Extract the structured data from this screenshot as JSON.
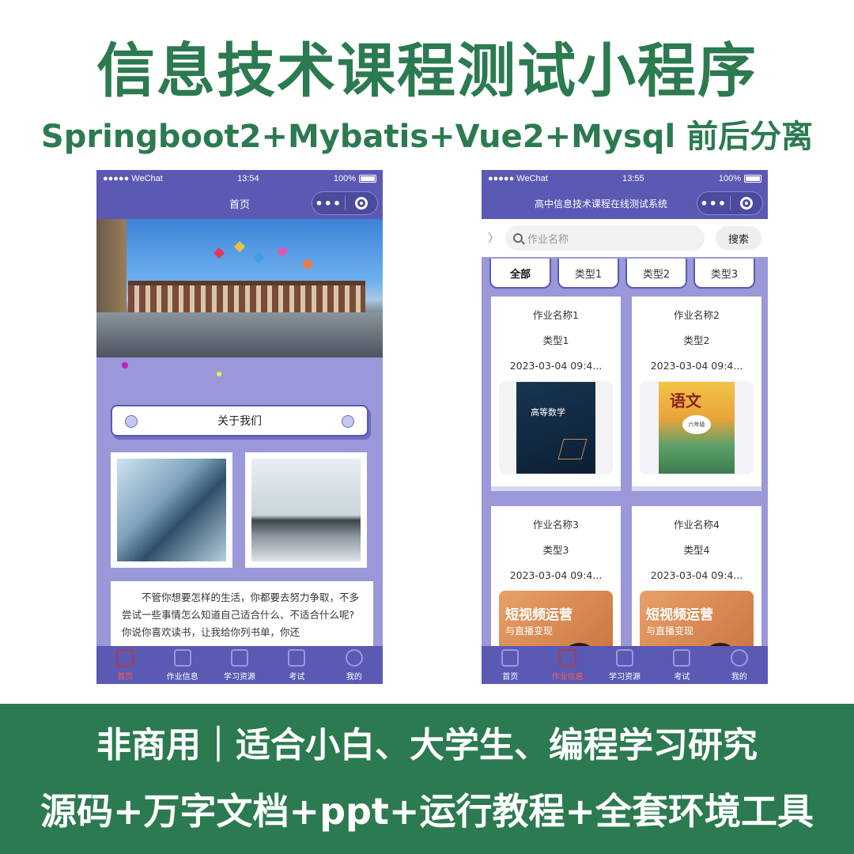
{
  "headline": "信息技术课程测试小程序",
  "subline": "Springboot2+Mybatis+Vue2+Mysql 前后分离",
  "left_phone": {
    "status": {
      "carrier": "●●●●● WeChat",
      "time": "13:54",
      "battery": "100%"
    },
    "nav_title": "首页",
    "about_button": "关于我们",
    "intro_text": "不管你想要怎样的生活，你都要去努力争取，不多尝试一些事情怎么知道自己适合什么、不适合什么呢? 你说你喜欢读书，让我给你列书单，你还",
    "tabs": [
      {
        "label": "首页",
        "active": true
      },
      {
        "label": "作业信息",
        "active": false
      },
      {
        "label": "学习资源",
        "active": false
      },
      {
        "label": "考试",
        "active": false
      },
      {
        "label": "我的",
        "active": false
      }
    ]
  },
  "right_phone": {
    "status": {
      "carrier": "●●●●● WeChat",
      "time": "13:55",
      "battery": "100%"
    },
    "nav_title": "高中信息技术课程在线测试系统",
    "search": {
      "placeholder": "作业名称",
      "button": "搜索"
    },
    "categories": [
      {
        "label": "全部",
        "active": true
      },
      {
        "label": "类型1",
        "active": false
      },
      {
        "label": "类型2",
        "active": false
      },
      {
        "label": "类型3",
        "active": false
      }
    ],
    "works": [
      {
        "name": "作业名称1",
        "type": "类型1",
        "date": "2023-03-04 09:4...",
        "cover": "高等数学"
      },
      {
        "name": "作业名称2",
        "type": "类型2",
        "date": "2023-03-04 09:4...",
        "cover": "语文",
        "cover_sub": "六年级"
      },
      {
        "name": "作业名称3",
        "type": "类型3",
        "date": "2023-03-04 09:4...",
        "cover": "短视频运营",
        "cover_sub": "与直播变现"
      },
      {
        "name": "作业名称4",
        "type": "类型4",
        "date": "2023-03-04 09:4...",
        "cover": "短视频运营",
        "cover_sub": "与直播变现"
      }
    ],
    "tabs": [
      {
        "label": "首页",
        "active": false
      },
      {
        "label": "作业信息",
        "active": true
      },
      {
        "label": "学习资源",
        "active": false
      },
      {
        "label": "考试",
        "active": false
      },
      {
        "label": "我的",
        "active": false
      }
    ]
  },
  "bottom": {
    "line1": "非商用｜适合小白、大学生、编程学习研究",
    "line2": "源码+万字文档+ppt+运行教程+全套环境工具"
  },
  "colors": {
    "brand_green": "#2c7a50",
    "app_purple": "#5a59b4",
    "active_tab": "#ff5a5a"
  }
}
